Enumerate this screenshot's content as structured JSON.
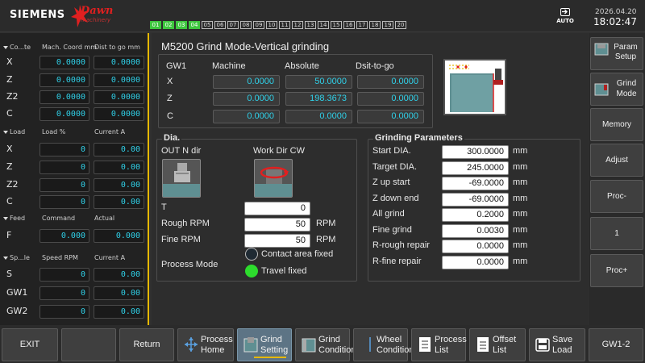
{
  "header": {
    "brand": "SIEMENS",
    "logo_word": "Dawn",
    "logo_sub": "machinery",
    "channels": [
      {
        "label": "01",
        "active": true
      },
      {
        "label": "02",
        "active": true
      },
      {
        "label": "03",
        "active": true
      },
      {
        "label": "04",
        "active": true
      },
      {
        "label": "05",
        "active": false
      },
      {
        "label": "06",
        "active": false
      },
      {
        "label": "07",
        "active": false
      },
      {
        "label": "08",
        "active": false
      },
      {
        "label": "09",
        "active": false
      },
      {
        "label": "10",
        "active": false
      },
      {
        "label": "11",
        "active": false
      },
      {
        "label": "12",
        "active": false
      },
      {
        "label": "13",
        "active": false
      },
      {
        "label": "14",
        "active": false
      },
      {
        "label": "15",
        "active": false
      },
      {
        "label": "16",
        "active": false
      },
      {
        "label": "17",
        "active": false
      },
      {
        "label": "18",
        "active": false
      },
      {
        "label": "19",
        "active": false
      },
      {
        "label": "20",
        "active": false
      }
    ],
    "mode": "AUTO",
    "date": "2026.04.20",
    "time": "18:02:47"
  },
  "left": {
    "coord": {
      "title": "Co...te",
      "col1": "Mach. Coord mm",
      "col2": "Dist to go mm",
      "rows": [
        {
          "axis": "X",
          "v1": "0.0000",
          "v2": "0.0000"
        },
        {
          "axis": "Z",
          "v1": "0.0000",
          "v2": "0.0000"
        },
        {
          "axis": "Z2",
          "v1": "0.0000",
          "v2": "0.0000"
        },
        {
          "axis": "C",
          "v1": "0.0000",
          "v2": "0.0000"
        }
      ]
    },
    "load": {
      "title": "Load",
      "col1": "Load %",
      "col2": "Current A",
      "rows": [
        {
          "axis": "X",
          "v1": "0",
          "v2": "0.00"
        },
        {
          "axis": "Z",
          "v1": "0",
          "v2": "0.00"
        },
        {
          "axis": "Z2",
          "v1": "0",
          "v2": "0.00"
        },
        {
          "axis": "C",
          "v1": "0",
          "v2": "0.00"
        }
      ]
    },
    "feed": {
      "title": "Feed",
      "col1": "Command",
      "col2": "Actual",
      "rows": [
        {
          "axis": "F",
          "v1": "0.000",
          "v2": "0.000"
        }
      ]
    },
    "spindle": {
      "title": "Sp...le",
      "col1": "Speed RPM",
      "col2": "Current A",
      "rows": [
        {
          "axis": "S",
          "v1": "0",
          "v2": "0.00"
        },
        {
          "axis": "GW1",
          "v1": "0",
          "v2": "0.00"
        },
        {
          "axis": "GW2",
          "v1": "0",
          "v2": "0.00"
        }
      ]
    }
  },
  "main": {
    "title": "M5200 Grind Mode-Vertical grinding",
    "pos": {
      "group": "GW1",
      "cols": [
        "Machine",
        "Absolute",
        "Dsit-to-go"
      ],
      "rows": [
        {
          "axis": "X",
          "machine": "0.0000",
          "absolute": "50.0000",
          "dtg": "0.0000"
        },
        {
          "axis": "Z",
          "machine": "0.0000",
          "absolute": "198.3673",
          "dtg": "0.0000"
        },
        {
          "axis": "C",
          "machine": "0.0000",
          "absolute": "0.0000",
          "dtg": "0.0000"
        }
      ]
    },
    "dia": {
      "title": "Dia.",
      "out_label": "OUT N dir",
      "work_label": "Work Dir CW",
      "t_label": "T",
      "t_value": "0",
      "rough_label": "Rough RPM",
      "rough_value": "50",
      "rough_unit": "RPM",
      "fine_label": "Fine RPM",
      "fine_value": "50",
      "fine_unit": "RPM",
      "process_label": "Process Mode",
      "opt1": "Contact area fixed",
      "opt2": "Travel fixed"
    },
    "grind": {
      "title": "Grinding Parameters",
      "rows": [
        {
          "label": "Start DIA.",
          "value": "300.0000",
          "unit": "mm"
        },
        {
          "label": "Target DIA.",
          "value": "245.0000",
          "unit": "mm"
        },
        {
          "label": "Z up start",
          "value": "-69.0000",
          "unit": "mm"
        },
        {
          "label": "Z down end",
          "value": "-69.0000",
          "unit": "mm"
        },
        {
          "label": "All grind",
          "value": "0.2000",
          "unit": "mm"
        },
        {
          "label": "Fine grind",
          "value": "0.0030",
          "unit": "mm"
        },
        {
          "label": "R-rough repair",
          "value": "0.0000",
          "unit": "mm"
        },
        {
          "label": "R-fine repair",
          "value": "0.0000",
          "unit": "mm"
        }
      ]
    }
  },
  "right": {
    "buttons": [
      "Param Setup",
      "Grind Mode",
      "Memory",
      "Adjust",
      "Proc-",
      "1",
      "Proc+"
    ]
  },
  "bottom": {
    "exit": "EXIT",
    "return": "Return",
    "buttons": [
      "Process Home",
      "Grind Setting",
      "Grind Condition",
      "Wheel Condition",
      "Process List",
      "Offset List",
      "Save Load"
    ],
    "gw": "GW1-2"
  }
}
